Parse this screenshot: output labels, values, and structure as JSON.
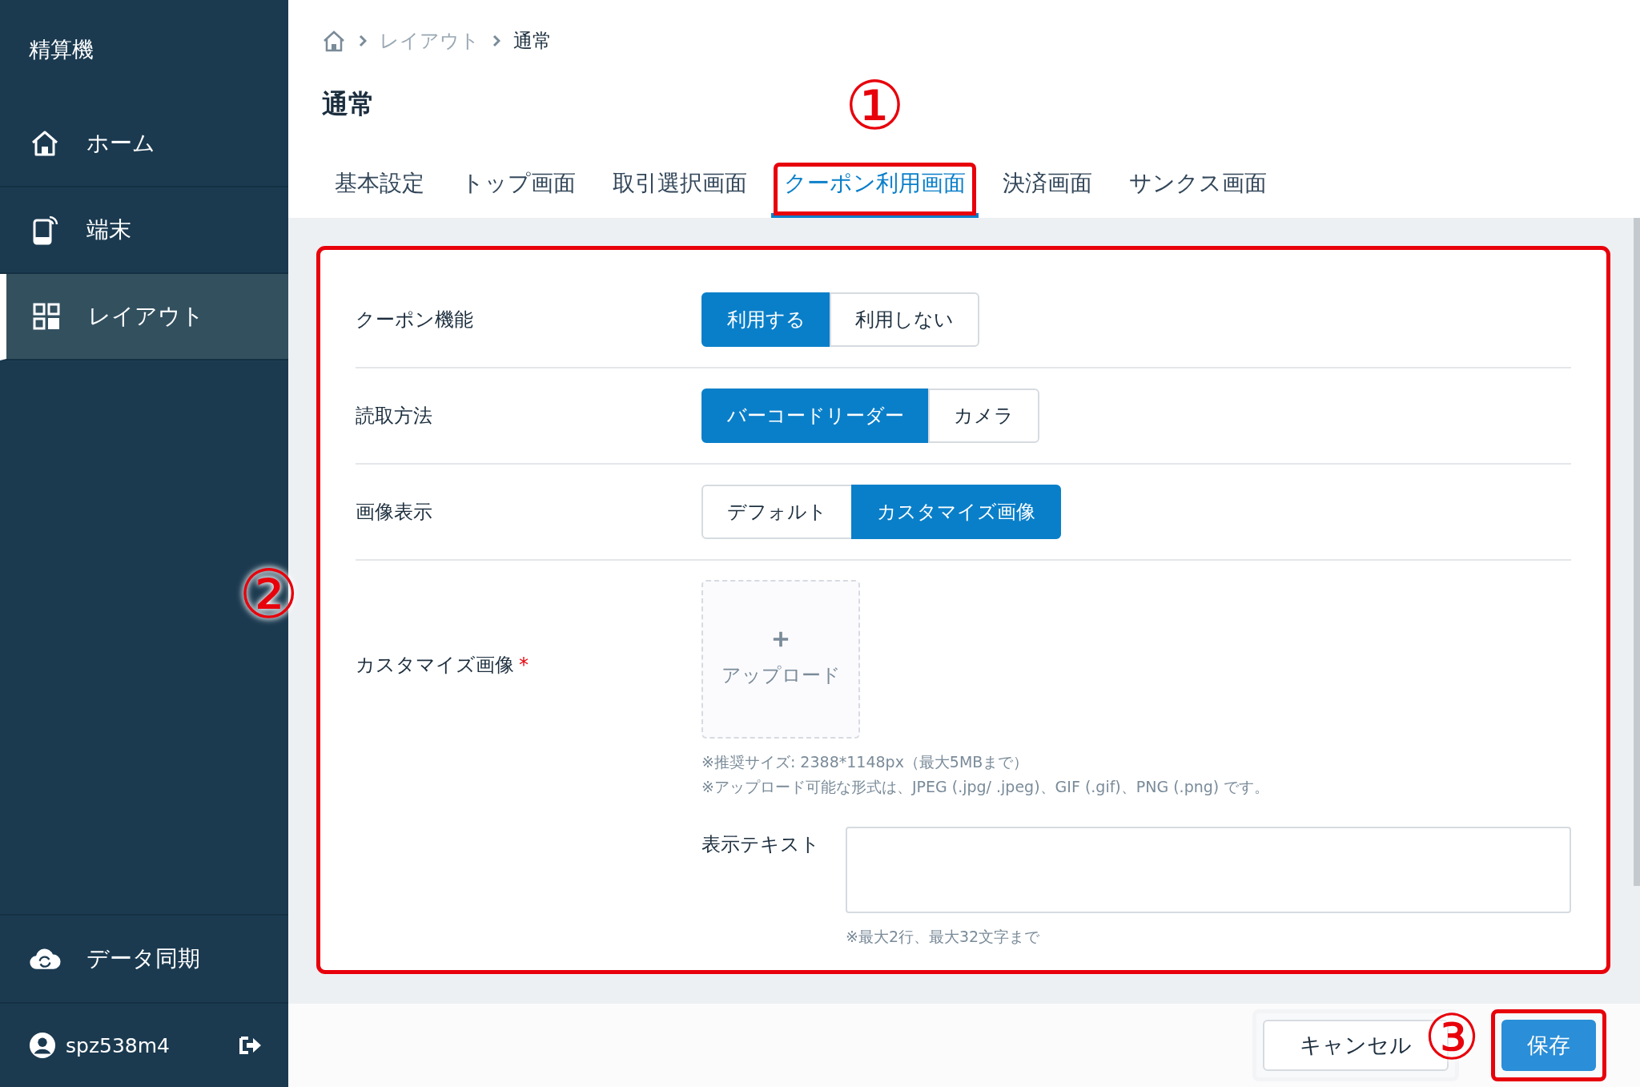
{
  "sidebar": {
    "title": "精算機",
    "items": [
      {
        "kind": "home",
        "label": "ホーム",
        "selected": false
      },
      {
        "kind": "device",
        "label": "端末",
        "selected": false
      },
      {
        "kind": "layout",
        "label": "レイアウト",
        "selected": true
      }
    ],
    "sync": {
      "label": "データ同期"
    },
    "user": {
      "name": "spz538m4"
    }
  },
  "breadcrumb": [
    "レイアウト",
    "通常"
  ],
  "page_title": "通常",
  "tabs": [
    {
      "label": "基本設定",
      "selected": false,
      "highlighted": false
    },
    {
      "label": "トップ画面",
      "selected": false,
      "highlighted": false
    },
    {
      "label": "取引選択画面",
      "selected": false,
      "highlighted": false
    },
    {
      "label": "クーポン利用画面",
      "selected": true,
      "highlighted": true,
      "callout": "①"
    },
    {
      "label": "決済画面",
      "selected": false,
      "highlighted": false
    },
    {
      "label": "サンクス画面",
      "selected": false,
      "highlighted": false
    }
  ],
  "form": {
    "highlighted": true,
    "callout": "②",
    "rows": [
      {
        "kind": "segmented",
        "label": "クーポン機能",
        "options": [
          {
            "label": "利用する",
            "selected": true
          },
          {
            "label": "利用しない",
            "selected": false
          }
        ]
      },
      {
        "kind": "segmented",
        "label": "読取方法",
        "options": [
          {
            "label": "バーコードリーダー",
            "selected": true
          },
          {
            "label": "カメラ",
            "selected": false
          }
        ]
      },
      {
        "kind": "segmented",
        "label": "画像表示",
        "options": [
          {
            "label": "デフォルト",
            "selected": false
          },
          {
            "label": "カスタマイズ画像",
            "selected": true
          }
        ]
      },
      {
        "kind": "upload",
        "label": "カスタマイズ画像",
        "required_mark": "*",
        "upload_label": "アップロード",
        "notes": [
          "※推奨サイズ: 2388*1148px（最大5MBまで）",
          "※アップロード可能な形式は、JPEG (.jpg/ .jpeg)、GIF (.gif)、PNG (.png) です。"
        ],
        "text_field": {
          "label": "表示テキスト",
          "note": "※最大2行、最大32文字まで"
        }
      }
    ]
  },
  "footer": {
    "buttons": [
      {
        "kind": "secondary",
        "label": "キャンセル",
        "highlighted": false
      },
      {
        "kind": "primary",
        "label": "保存",
        "highlighted": true,
        "callout": "③"
      }
    ]
  }
}
